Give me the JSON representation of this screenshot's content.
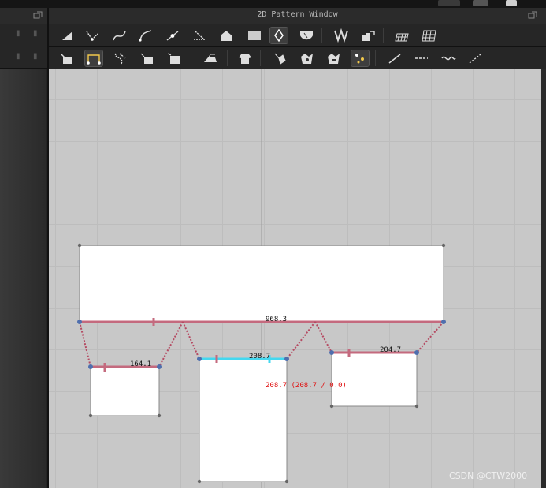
{
  "window": {
    "title": "2D Pattern Window"
  },
  "toolbar_row1": [
    "triangle-select-icon",
    "point-edit-icon",
    "curve-point-icon",
    "bezier-curve-icon",
    "add-point-icon",
    "segment-icon",
    "internal-shape-icon",
    "rectangle-icon",
    "ellipse-icon",
    "dart-icon",
    "fold-icon",
    "trace-icon",
    "grid-icon",
    "mesh-icon"
  ],
  "toolbar_row2": [
    "seam-select-icon",
    "segment-sew-icon",
    "free-sew-icon",
    "tack-icon",
    "tack-move-icon",
    "iron-icon",
    "garment-icon",
    "pin-icon",
    "button-icon",
    "buttonhole-icon",
    "pattern-node-icon",
    "line-icon",
    "dashed-line-icon",
    "wave-line-icon",
    "zigzag-icon"
  ],
  "measurements": {
    "top_edge": "968.3",
    "left_piece": "164.1",
    "middle_piece": "208.7",
    "right_piece": "204.7",
    "middle_detail": "208.7 (208.7 / 0.0)"
  },
  "watermark": "CSDN @CTW2000",
  "colors": {
    "seam": "#c46a7e",
    "sew_dots": "#b54a62",
    "highlight": "#44d8f0",
    "point": "#4f6fae"
  }
}
